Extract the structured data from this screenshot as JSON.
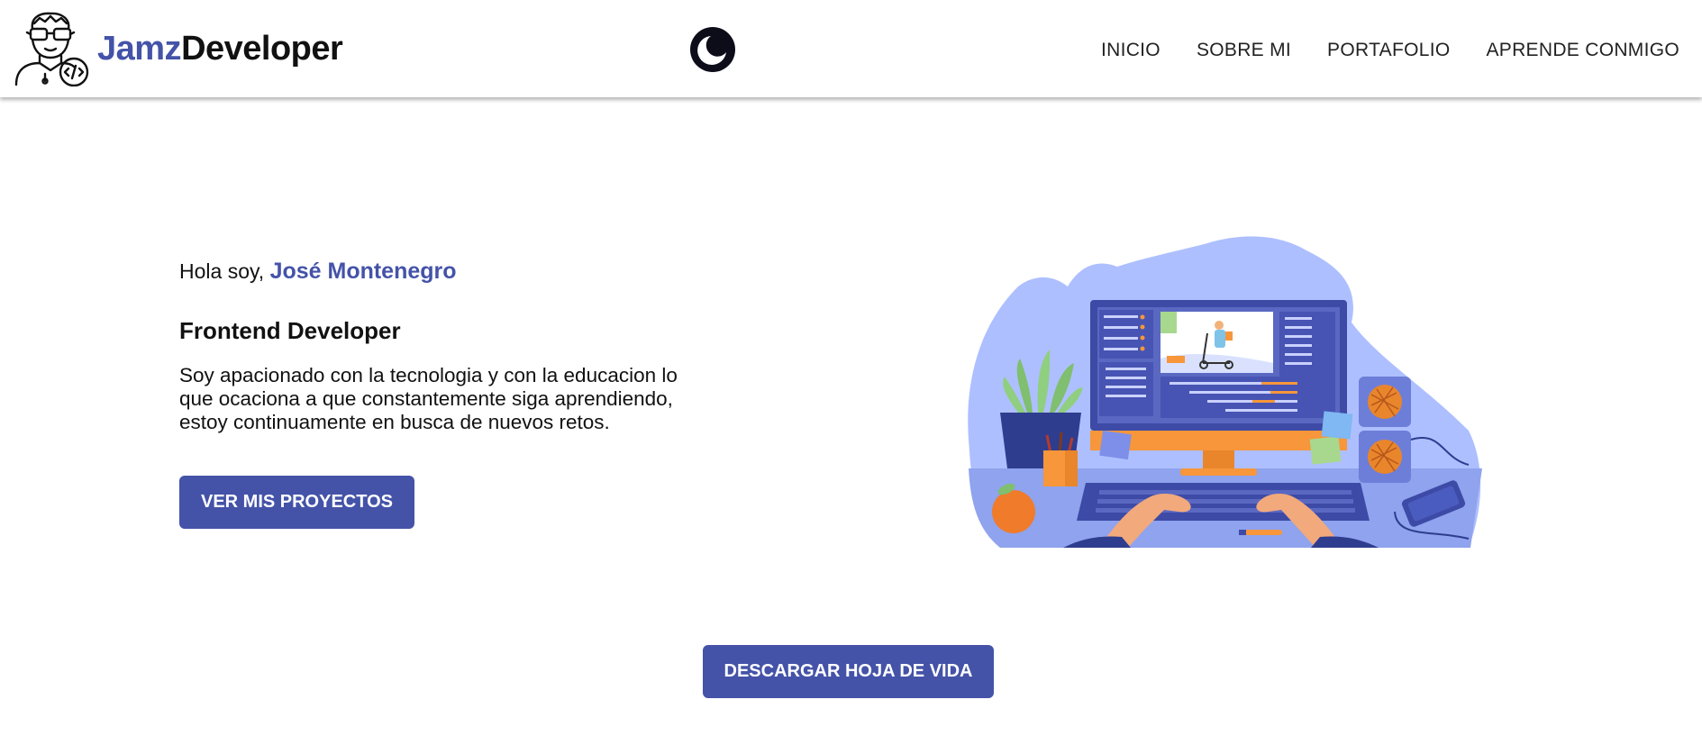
{
  "header": {
    "brand_part1": "Jamz",
    "brand_part2": "Developer",
    "logo_icon": "developer-avatar-icon",
    "theme_icon": "moon-icon",
    "nav": [
      "INICIO",
      "SOBRE MI",
      "PORTAFOLIO",
      "APRENDE CONMIGO"
    ]
  },
  "hero": {
    "greeting": "Hola soy, ",
    "name": "José Montenegro",
    "role": "Frontend Developer",
    "description": "Soy apacionado con la tecnologia y con la educacion lo que ocaciona a que constantemente siga aprendiendo, estoy continuamente en busca de nuevos retos.",
    "projects_button": "VER MIS PROYECTOS",
    "illustration": "developer-workspace-illustration"
  },
  "cv_button": "DESCARGAR HOJA DE VIDA",
  "colors": {
    "accent": "#4453a8",
    "illustration_bg": "#aebfff",
    "orange": "#f7963a"
  }
}
